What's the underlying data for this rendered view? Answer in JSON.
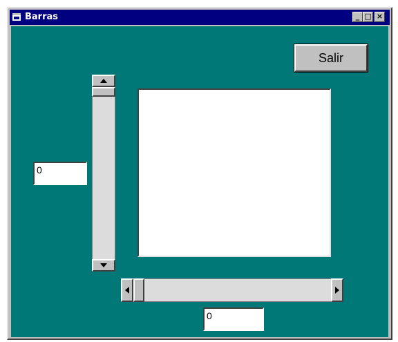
{
  "window": {
    "title": "Barras",
    "controls": {
      "minimize": "_",
      "maximize": "□",
      "close": "×"
    }
  },
  "exit_button": {
    "label": "Salir"
  },
  "vertical_value": {
    "value": "0"
  },
  "horizontal_value": {
    "value": "0"
  },
  "vertical_scrollbar": {
    "level": 0
  },
  "horizontal_scrollbar": {
    "level": 0
  },
  "colors": {
    "titlebar": "#000080",
    "client_background": "#007878",
    "control_face": "#c0c0c0"
  },
  "icons": {
    "window": "app-window-icon",
    "up": "arrow-up-icon",
    "down": "arrow-down-icon",
    "left": "arrow-left-icon",
    "right": "arrow-right-icon"
  }
}
